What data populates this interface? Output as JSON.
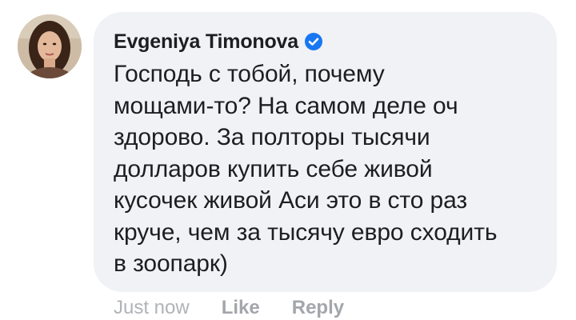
{
  "comment": {
    "author": {
      "name": "Evgeniya Timonova",
      "verified": true,
      "avatar_icon": "user-avatar"
    },
    "text": "Господь с тобой, почему\nмощами-то? На самом деле оч\nздорово. За полторы тысячи\nдолларов купить себе живой\nкусочек живой Аси это в сто раз\nкруче, чем за тысячу евро сходить\nв зоопарк)",
    "timestamp": "Just now",
    "actions": {
      "like_label": "Like",
      "reply_label": "Reply"
    }
  },
  "colors": {
    "bubble_background": "#f0f2f5",
    "verified_badge": "#1877f2",
    "text": "#1c1e21",
    "muted": "#b0b3b8"
  }
}
